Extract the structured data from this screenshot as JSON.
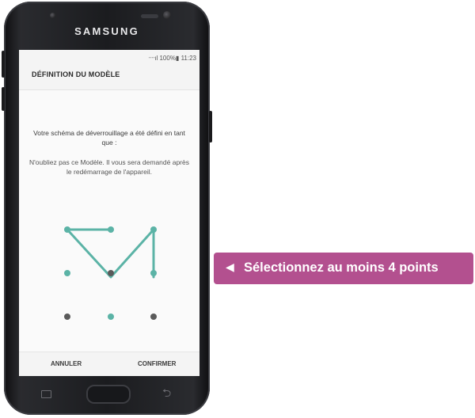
{
  "device": {
    "brand": "SAMSUNG"
  },
  "status_bar": {
    "text": "᠁ıl 100%▮ 11:23"
  },
  "screen": {
    "title": "DÉFINITION DU MODÈLE",
    "message_primary": "Votre schéma de déverrouillage a été défini en tant que :",
    "message_secondary": "N'oubliez pas ce Modèle. Il vous sera demandé après le redémarrage de l'appareil.",
    "cancel_label": "ANNULER",
    "confirm_label": "CONFIRMER"
  },
  "pattern": {
    "grid": "3x3",
    "selected_sequence": [
      [
        1,
        1
      ],
      [
        0,
        1
      ],
      [
        0,
        2
      ],
      [
        1,
        3
      ],
      [
        2,
        1
      ],
      [
        3,
        1
      ]
    ],
    "path_color": "#5bb3a6",
    "dot_color": "#5a5a5a"
  },
  "callout": {
    "arrow": "◀",
    "text": "Sélectionnez au moins 4 points",
    "background": "#b3508f"
  },
  "icons": [
    "recent-apps-icon",
    "home-button",
    "back-icon",
    "signal-icon",
    "battery-icon"
  ]
}
